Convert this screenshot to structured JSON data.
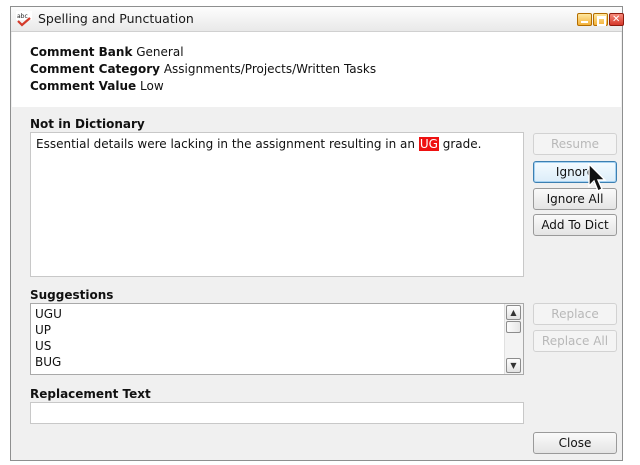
{
  "window": {
    "title": "Spelling and Punctuation"
  },
  "info": {
    "bank_label": "Comment Bank",
    "bank_value": "General",
    "category_label": "Comment Category",
    "category_value": "Assignments/Projects/Written Tasks",
    "value_label": "Comment Value",
    "value_value": "Low"
  },
  "dictionary": {
    "label": "Not in Dictionary",
    "text_before": "Essential details were lacking in the assignment resulting in an ",
    "misspelled": "UG",
    "text_after": " grade."
  },
  "buttons": {
    "resume": "Resume",
    "ignore": "Ignore",
    "ignore_all": "Ignore All",
    "add_to_dict": "Add To Dict",
    "replace": "Replace",
    "replace_all": "Replace All",
    "close": "Close"
  },
  "suggestions": {
    "label": "Suggestions",
    "items": [
      "UGU",
      "UP",
      "US",
      "BUG"
    ]
  },
  "replacement": {
    "label": "Replacement Text",
    "value": ""
  },
  "colors": {
    "highlight": "#ee1111",
    "focus_border": "#3c7fb1"
  },
  "icons": {
    "app": "spellcheck-abc-icon",
    "cursor": "mouse-pointer-icon"
  }
}
